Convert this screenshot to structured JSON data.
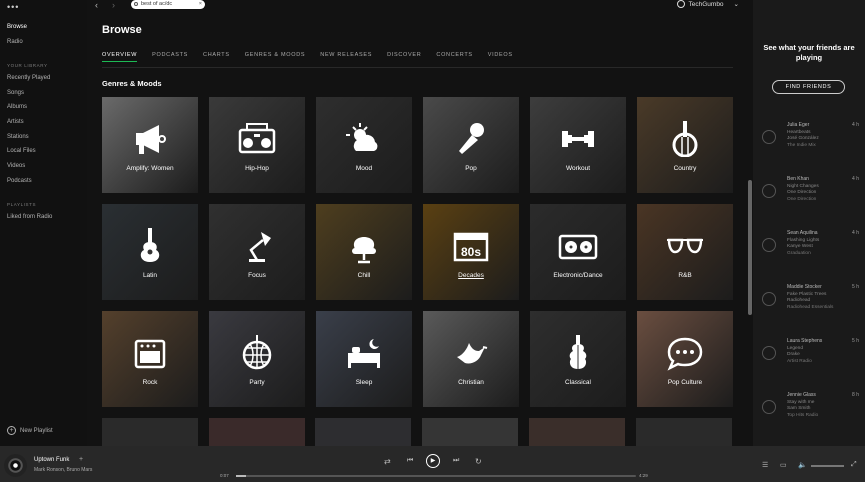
{
  "sidebar": {
    "browse": "Browse",
    "radio": "Radio",
    "your_library_heading": "YOUR LIBRARY",
    "library": [
      "Recently Played",
      "Songs",
      "Albums",
      "Artists",
      "Stations",
      "Local Files",
      "Videos",
      "Podcasts"
    ],
    "playlists_heading": "PLAYLISTS",
    "playlists": [
      "Liked from Radio"
    ],
    "new_playlist": "New Playlist"
  },
  "topbar": {
    "search_value": "best of ac/dc",
    "username": "TechGumbo"
  },
  "page": {
    "title": "Browse",
    "section_title": "Genres & Moods"
  },
  "tabs": [
    "OVERVIEW",
    "PODCASTS",
    "CHARTS",
    "GENRES & MOODS",
    "NEW RELEASES",
    "DISCOVER",
    "CONCERTS",
    "VIDEOS"
  ],
  "active_tab": "OVERVIEW",
  "tiles": [
    {
      "label": "Amplify: Women",
      "icon": "megaphone-icon",
      "bg": "#6a6a6a"
    },
    {
      "label": "Hip-Hop",
      "icon": "boombox-icon",
      "bg": "#3a3a3a"
    },
    {
      "label": "Mood",
      "icon": "weather-icon",
      "bg": "#2e2e2e"
    },
    {
      "label": "Pop",
      "icon": "microphone-icon",
      "bg": "#4a4a4a"
    },
    {
      "label": "Workout",
      "icon": "dumbbell-icon",
      "bg": "#3d3d3d"
    },
    {
      "label": "Country",
      "icon": "banjo-icon",
      "bg": "#4a3a28"
    },
    {
      "label": "Latin",
      "icon": "guitar-icon",
      "bg": "#2a2f33"
    },
    {
      "label": "Focus",
      "icon": "lamp-icon",
      "bg": "#303030"
    },
    {
      "label": "Chill",
      "icon": "chair-icon",
      "bg": "#4e3e1e"
    },
    {
      "label": "Decades",
      "icon": "calendar-80s-icon",
      "bg": "#5a4012"
    },
    {
      "label": "Electronic/Dance",
      "icon": "turntable-icon",
      "bg": "#2b2b2b"
    },
    {
      "label": "R&B",
      "icon": "sunglasses-icon",
      "bg": "#4a3524"
    },
    {
      "label": "Rock",
      "icon": "amplifier-icon",
      "bg": "#54402c"
    },
    {
      "label": "Party",
      "icon": "disco-ball-icon",
      "bg": "#3a3a40"
    },
    {
      "label": "Sleep",
      "icon": "bed-icon",
      "bg": "#3a3f4a"
    },
    {
      "label": "Christian",
      "icon": "dove-icon",
      "bg": "#5a5a5a"
    },
    {
      "label": "Classical",
      "icon": "violin-icon",
      "bg": "#2e2e2e"
    },
    {
      "label": "Pop Culture",
      "icon": "speech-bubble-icon",
      "bg": "#6a4e40"
    }
  ],
  "friends": {
    "title": "See what your friends are playing",
    "button": "FIND FRIENDS",
    "items": [
      {
        "name": "Julia Eger",
        "time": "4 h",
        "track": "Heartbeats",
        "artist": "José González",
        "source": "The Indie Mix"
      },
      {
        "name": "Ben Khan",
        "time": "4 h",
        "track": "Night Changes",
        "artist": "One Direction",
        "source": "One Direction"
      },
      {
        "name": "Sean Aquilina",
        "time": "4 h",
        "track": "Flashing Lights",
        "artist": "Kanye West",
        "source": "Graduation"
      },
      {
        "name": "Maddie Stocker",
        "time": "5 h",
        "track": "Fake Plastic Trees",
        "artist": "Radiohead",
        "source": "Radiohead Essentials"
      },
      {
        "name": "Laura Stephens",
        "time": "5 h",
        "track": "Legend",
        "artist": "Drake",
        "source": "Artist Radio"
      },
      {
        "name": "Jennie Glass",
        "time": "8 h",
        "track": "Stay with me",
        "artist": "Sam Smith",
        "source": "Top Hits Radio"
      }
    ]
  },
  "player": {
    "track": "Uptown Funk",
    "artists": "Mark Ronson, Bruno Mars",
    "elapsed": "0:07",
    "duration": "4:29",
    "progress": 0.026
  }
}
